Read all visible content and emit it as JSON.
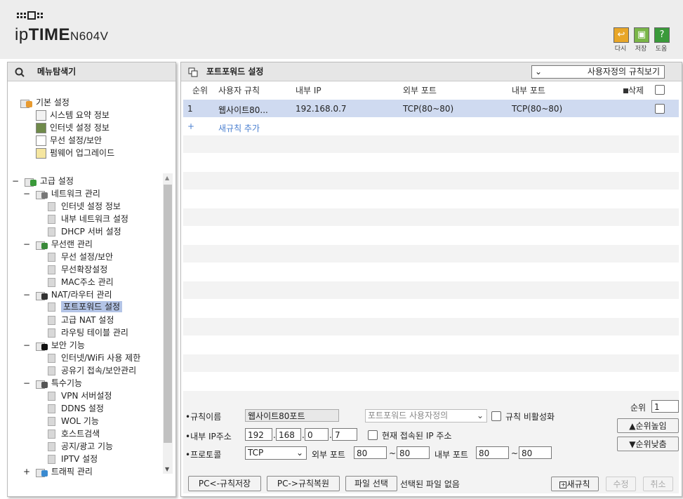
{
  "header": {
    "brand_ip": "ip",
    "brand_time": "TIME",
    "model": "N604V",
    "buttons": [
      {
        "label": "다시",
        "color": "#e8a628"
      },
      {
        "label": "저장",
        "color": "#7ab648"
      },
      {
        "label": "도움",
        "color": "#3a9a3a",
        "glyph": "?"
      }
    ]
  },
  "sidebar": {
    "title": "메뉴탐색기",
    "basic": {
      "label": "기본 설정",
      "items": [
        "시스템 요약 정보",
        "인터넷 설정 정보",
        "무선 설정/보안",
        "펌웨어 업그레이드"
      ]
    },
    "advanced": {
      "label": "고급 설정",
      "groups": [
        {
          "label": "네트워크 관리",
          "items": [
            "인터넷 설정 정보",
            "내부 네트워크 설정",
            "DHCP 서버 설정"
          ]
        },
        {
          "label": "무선랜 관리",
          "items": [
            "무선 설정/보안",
            "무선확장설정",
            "MAC주소 관리"
          ]
        },
        {
          "label": "NAT/라우터 관리",
          "items": [
            "포트포워드 설정",
            "고급 NAT 설정",
            "라우팅 테이블 관리"
          ]
        },
        {
          "label": "보안 기능",
          "items": [
            "인터넷/WiFi 사용 제한",
            "공유기 접속/보안관리"
          ]
        },
        {
          "label": "특수기능",
          "items": [
            "VPN 서버설정",
            "DDNS 설정",
            "WOL 기능",
            "호스트검색",
            "공지/광고 기능",
            "IPTV 설정"
          ]
        },
        {
          "label": "트래픽 관리",
          "items": []
        }
      ]
    }
  },
  "main": {
    "title": "포트포워드 설정",
    "view_select": "사용자정의 규칙보기",
    "columns": {
      "no": "순위",
      "rule": "사용자 규칙",
      "internal_ip": "내부 IP",
      "external_port": "외부 포트",
      "internal_port": "내부 포트",
      "delete": "삭제"
    },
    "rows": [
      {
        "no": "1",
        "rule": "웹사이트80...",
        "internal_ip": "192.168.0.7",
        "external_port": "TCP(80~80)",
        "internal_port": "TCP(80~80)"
      }
    ],
    "add_rule": "새규칙 추가",
    "form": {
      "rule_name_label": "규칙이름",
      "rule_name_value": "웹사이트80포트",
      "preset_select": "포트포워드 사용자정의",
      "disable_label": "규칙 비활성화",
      "priority_label": "순위",
      "priority_value": "1",
      "up_button": "▲순위높임",
      "down_button": "▼순위낮춤",
      "ip_label": "내부 IP주소",
      "ip": [
        "192",
        "168",
        "0",
        "7"
      ],
      "current_ip_label": "현재 접속된 IP 주소",
      "protocol_label": "프로토콜",
      "protocol_value": "TCP",
      "ext_port_label": "외부 포트",
      "ext_port_from": "80",
      "ext_port_to": "80",
      "int_port_label": "내부 포트",
      "int_port_from": "80",
      "int_port_to": "80"
    },
    "bottom": {
      "save_pc": "PC<-규칙저장",
      "restore_pc": "PC->규칙복원",
      "choose_file": "파일 선택",
      "no_file": "선택된 파일 없음",
      "new_rule": "새규칙",
      "modify": "수정",
      "cancel": "취소"
    }
  }
}
